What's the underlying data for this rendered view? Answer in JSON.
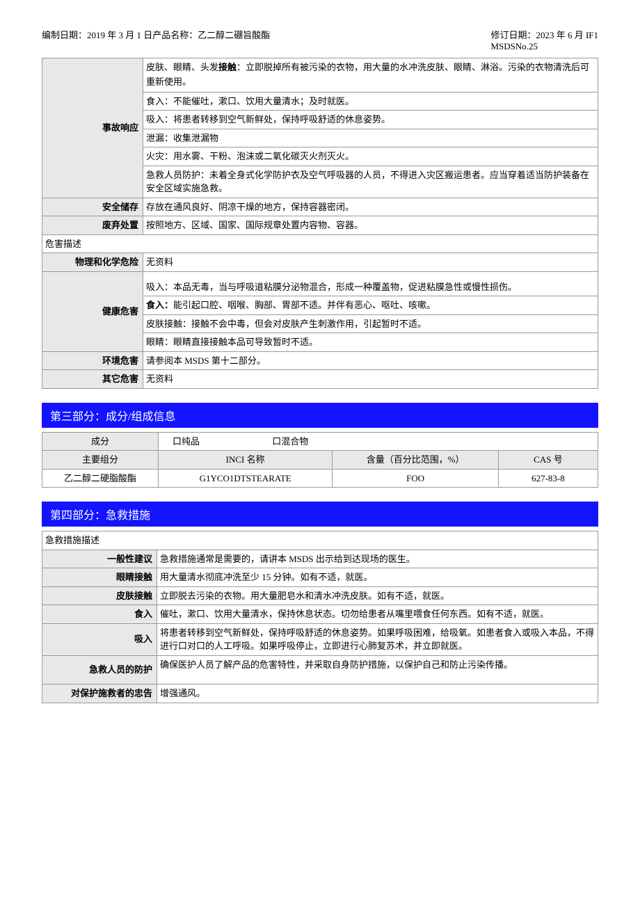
{
  "header": {
    "left": "编制日期：2019 年 3 月 1 日产品名称：乙二醇二硼旨酸酯",
    "right_line1": "修订日期：2023 年 6 月 IF1",
    "right_line2": "MSDSNo.25"
  },
  "table1": {
    "accident_label": "事故响应",
    "accident_line1a": "皮肤、眼睛、头发",
    "accident_line1b": "接触",
    "accident_line1c": "：立即脱掉所有被污染的衣物，用大量的水冲洗皮肤、眼睛、淋浴。污染的衣物清洗后可重新使用。",
    "accident_line2": "食入：不能催吐，漱口、饮用大量清水；及时就医。",
    "accident_line3": "吸入：将患者转移到空气新鲜处，保持呼吸舒适的休息姿势。",
    "accident_line4": "泄漏：收集泄漏物",
    "accident_line5": "火灾：用水雾、干粉、泡沫或二氧化碳灭火剂灭火。",
    "accident_line6": "急救人员防护：未着全身式化学防护衣及空气呼吸器的人员，不得进入灾区搬运患者。应当穿着适当防护装备在安全区域实施急救。",
    "storage_label": "安全储存",
    "storage_value": "存放在通风良好、阴凉干燥的地方，保持容器密闭。",
    "disposal_label": "废弃处置",
    "disposal_value": "按照地方、区域、国家、国际规章处置内容物、容器。",
    "hazard_desc": "危害描述",
    "phys_chem_label": "物理和化学危险",
    "phys_chem_value": "无资料",
    "health_label": "健康危害",
    "health_line1": "吸入：本品无毒，当与呼吸道粘膜分泌物混合，形成一种覆盖物，促进粘膜急性或慢性损伤。",
    "health_line2a": "食入：",
    "health_line2b": "能引起口腔、咽喉、胸部、胃部不适。并伴有恶心、呕吐、咳嗽。",
    "health_line3": "皮肤接触：接触不会中毒，但会对皮肤产生刺激作用，引起暂时不适。",
    "health_line4": "眼睛：眼睛直接接触本品可导致暂时不适。",
    "env_label": "环境危害",
    "env_value": "请参阅本 MSDS 第十二部分。",
    "other_label": "其它危害",
    "other_value": "无资料"
  },
  "section3": {
    "title": "第三部分：成分/组成信息",
    "comp_label": "成分",
    "pure": "口纯品",
    "mixture": "口混合物",
    "col1": "主要组分",
    "col2": "INCI 名称",
    "col3": "含量（百分比范围，%）",
    "col4": "CAS 号",
    "row1_c1": "乙二醇二硬脂酸酯",
    "row1_c2": "G1YCO1DTSTEARATE",
    "row1_c3": "FOO",
    "row1_c4": "627-83-8"
  },
  "section4": {
    "title": "第四部分：急救措施",
    "desc": "急救措施描述",
    "general_label": "一般性建议",
    "general_value": "急救措施通常是需要的，请讲本 MSDS 出示给到达现场的医生。",
    "eye_label": "眼睛接触",
    "eye_value": "用大量清水彻底冲洗至少 15 分钟。如有不适，就医。",
    "skin_label": "皮肤接触",
    "skin_value": "立即脱去污染的衣物。用大量肥皂水和清水冲洗皮肤。如有不适，就医。",
    "ingest_label": "食入",
    "ingest_value": "催吐，漱口、饮用大量清水，保持休息状态。切勿给患者从嘴里喂食任何东西。如有不适，就医。",
    "inhale_label": "吸入",
    "inhale_value": "将患者转移到空气新鲜处，保持呼吸舒适的休息姿势。如果呼吸困难，给吸氧。如患者食入或吸入本品，不得进行口对口的人工呼吸。如果呼吸停止，立即进行心肺复苏术，并立即就医。",
    "protect_label": "急救人员的防护",
    "protect_value": "确保医护人员了解产品的危害特性，并采取自身防护措施，以保护自己和防止污染传播。",
    "rescue_label": "对保护施救者的忠告",
    "rescue_value": "增强通风。"
  }
}
